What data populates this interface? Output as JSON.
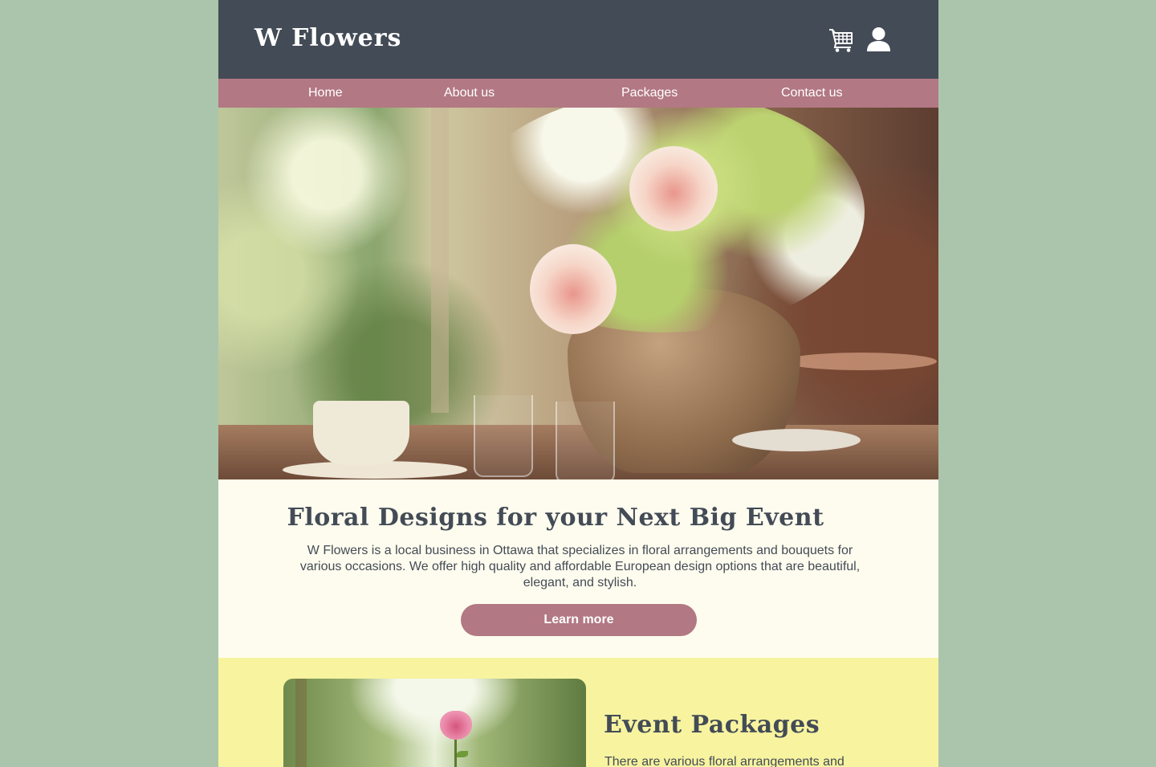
{
  "brand": {
    "name": "W Flowers"
  },
  "header": {
    "cart_icon": "cart-icon",
    "user_icon": "user-icon"
  },
  "nav": {
    "items": [
      {
        "label": "Home"
      },
      {
        "label": "About us"
      },
      {
        "label": "Packages"
      },
      {
        "label": "Contact us"
      }
    ]
  },
  "intro": {
    "title": "Floral Designs for your Next Big Event",
    "text": "W Flowers is a local business in Ottawa that specializes in floral arrangements and bouquets for various occasions. We offer high quality and affordable European design options that are beautiful, elegant, and stylish.",
    "button": "Learn more"
  },
  "packages": {
    "title": "Event Packages",
    "text": "There are various floral arrangements and"
  },
  "colors": {
    "page_background": "#aac5ab",
    "header": "#434b56",
    "nav": "#b27883",
    "content_background": "#fefcee",
    "packages_background": "#f7f39f",
    "button": "#b27883",
    "text": "#434b56"
  }
}
